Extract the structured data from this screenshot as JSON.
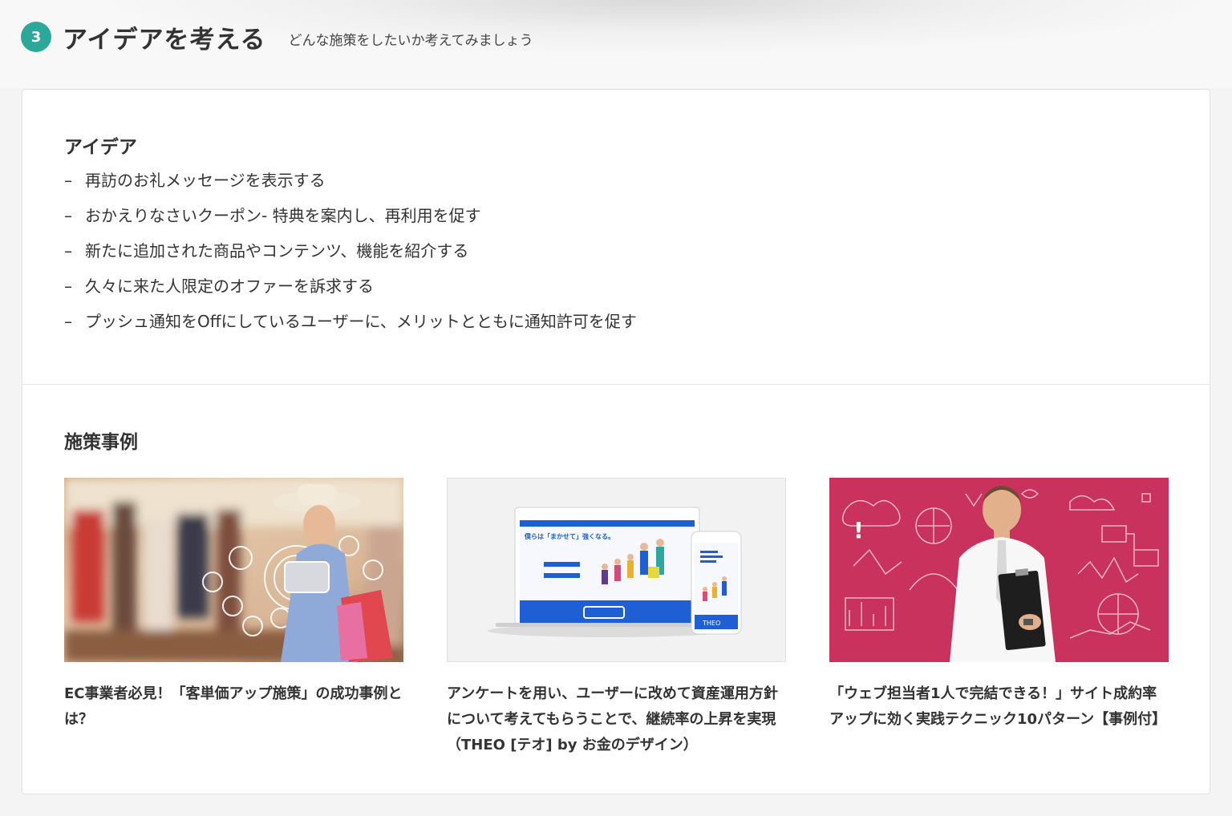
{
  "header": {
    "step_number": "3",
    "title": "アイデアを考える",
    "subtitle": "どんな施策をしたいか考えてみましょう"
  },
  "ideas": {
    "title": "アイデア",
    "items": [
      "再訪のお礼メッセージを表示する",
      "おかえりなさいクーポン- 特典を案内し、再利用を促す",
      "新たに追加された商品やコンテンツ、機能を紹介する",
      "久々に来た人限定のオファーを訴求する",
      "プッシュ通知をOffにしているユーザーに、メリットとともに通知許可を促す"
    ],
    "bullet": "–"
  },
  "cases": {
    "title": "施策事例",
    "items": [
      {
        "title": "EC事業者必見！「客単価アップ施策」の成功事例とは？",
        "thumb": "shopping-woman-photo"
      },
      {
        "title": "アンケートを用い、ユーザーに改めて資産運用方針について考えてもらうことで、継続率の上昇を実現（THEO [テオ] by お金のデザイン）",
        "thumb": "theo-website-mockup",
        "mockup_text": {
          "headline": "僕らは「まかせて」強くなる。",
          "phone_headline": "僕らは「まかせて」強くなる。",
          "logo": "THEO"
        }
      },
      {
        "title": "「ウェブ担当者1人で完結できる！」サイト成約率アップに効く実践テクニック10パターン【事例付】",
        "thumb": "businessman-whiteboard-photo"
      }
    ]
  },
  "colors": {
    "accent": "#2ba89a",
    "theo_blue": "#1f5fd6",
    "pink_bg": "#c8325c"
  }
}
